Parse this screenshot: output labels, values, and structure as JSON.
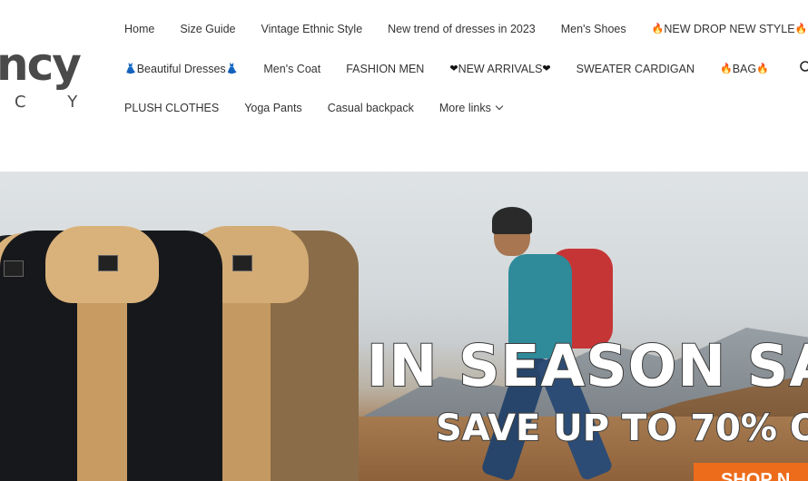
{
  "logo": {
    "main": "ncy",
    "sub": "C Y"
  },
  "nav": {
    "row1": [
      "Home",
      "Size Guide",
      "Vintage Ethnic Style",
      "New trend of dresses in 2023",
      "Men's Shoes",
      "NEW DROP NEW STYLE"
    ],
    "row2": [
      "Beautiful Dresses",
      "Men's Coat",
      "FASHION MEN",
      "NEW ARRIVALS",
      "SWEATER CARDIGAN",
      "BAG"
    ],
    "row3": [
      "PLUSH CLOTHES",
      "Yoga Pants",
      "Casual backpack",
      "More links"
    ]
  },
  "icons": {
    "fire": "🔥",
    "dress": "👗",
    "heart": "❤",
    "search": "search-icon"
  },
  "hero": {
    "headline": "IN SEASON SA",
    "subline": "SAVE UP TO 70% O",
    "button": "SHOP N",
    "tag_text": "jacket-tag"
  },
  "colors": {
    "accent": "#ec6c1c",
    "text": "#333333"
  }
}
